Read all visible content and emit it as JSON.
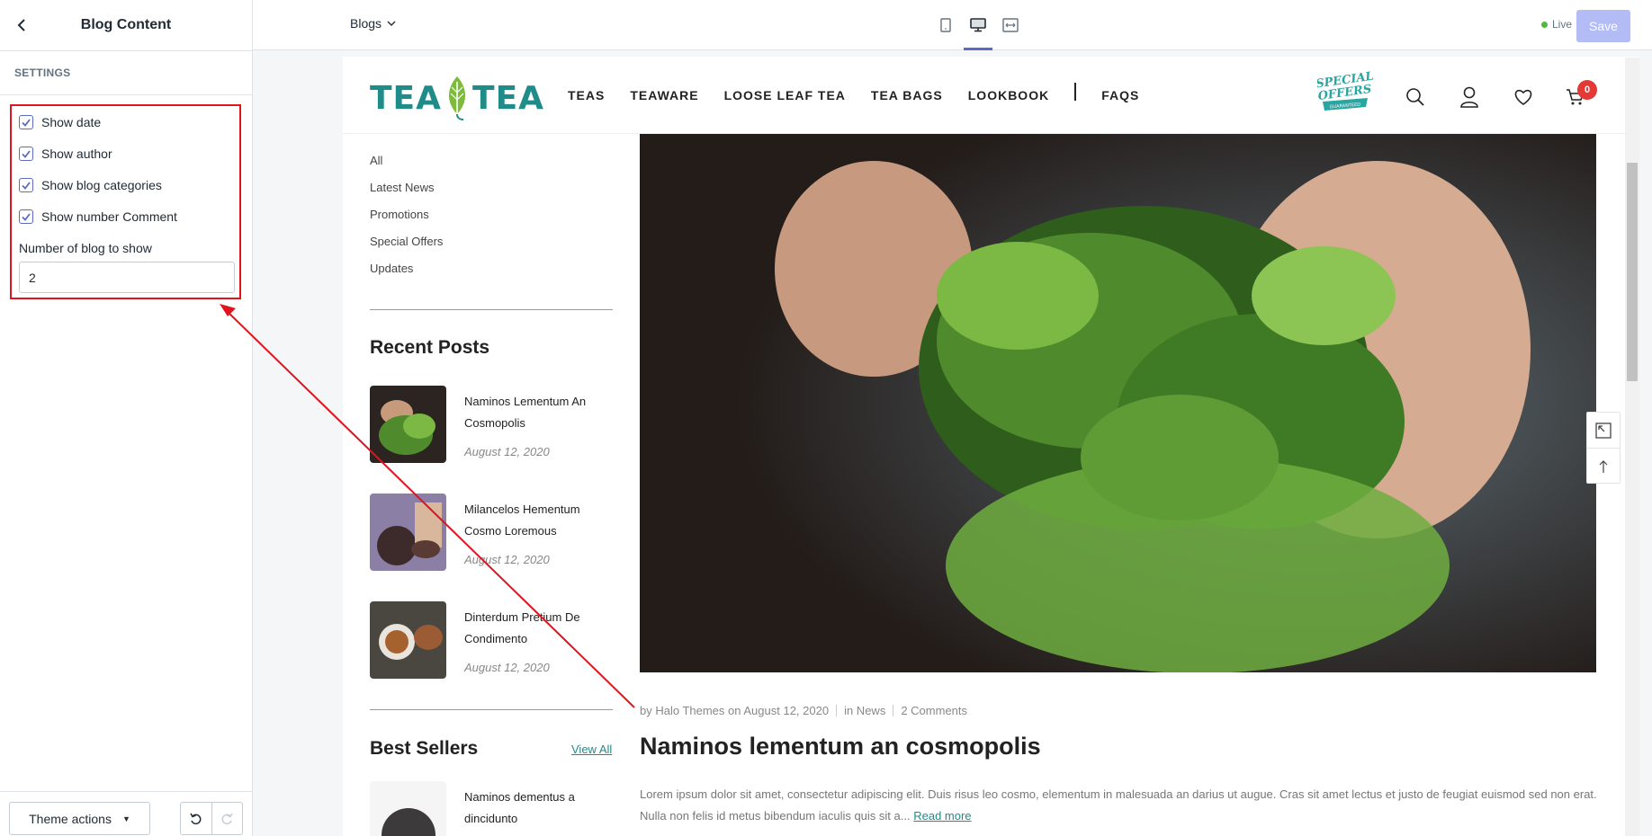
{
  "sidebar": {
    "title": "Blog Content",
    "section_label": "SETTINGS",
    "checkboxes": [
      {
        "label": "Show date",
        "checked": true
      },
      {
        "label": "Show author",
        "checked": true
      },
      {
        "label": "Show blog categories",
        "checked": true
      },
      {
        "label": "Show number Comment",
        "checked": true
      }
    ],
    "number_label": "Number of blog to show",
    "number_value": "2",
    "theme_actions_label": "Theme actions"
  },
  "topbar": {
    "page_select": "Blogs",
    "view_modes": [
      "mobile-view-icon",
      "desktop-view-icon",
      "fullscreen-view-icon"
    ],
    "active_view": "desktop",
    "live_label": "Live",
    "save_label": "Save"
  },
  "store": {
    "logo_text_left": "TEA",
    "logo_text_right": "TEA",
    "nav": [
      "TEAS",
      "TEAWARE",
      "LOOSE LEAF TEA",
      "TEA BAGS",
      "LOOKBOOK",
      "FAQS"
    ],
    "special_offers": [
      "SPECIAL",
      "OFFERS",
      "GUARANTEED"
    ],
    "cart_count": "0",
    "categories": [
      "All",
      "Latest News",
      "Promotions",
      "Special Offers",
      "Updates"
    ],
    "recent_posts_heading": "Recent Posts",
    "recent_posts": [
      {
        "title": "Naminos Lementum An Cosmopolis",
        "date": "August 12, 2020"
      },
      {
        "title": "Milancelos Hementum Cosmo Loremous",
        "date": "August 12, 2020"
      },
      {
        "title": "Dinterdum Pretium De Condimento",
        "date": "August 12, 2020"
      }
    ],
    "best_sellers_heading": "Best Sellers",
    "view_all": "View All",
    "best_seller_title": "Naminos dementus a dincidunto",
    "post": {
      "by": "by Halo Themes on August 12, 2020",
      "category": "in News",
      "comments": "2 Comments",
      "title": "Naminos lementum an cosmopolis",
      "excerpt": "Lorem ipsum dolor sit amet, consectetur adipiscing elit. Duis risus leo cosmo, elementum in malesuada an darius ut augue. Cras sit amet lectus et justo de feugiat euismod sed non erat. Nulla non felis id metus bibendum iaculis quis sit a...",
      "read_more": "Read more"
    }
  },
  "colors": {
    "annotation": "#e0141e",
    "brand_teal": "#1f8c8a",
    "save_disabled": "#b3bcf5",
    "accent": "#5c6ac4"
  }
}
